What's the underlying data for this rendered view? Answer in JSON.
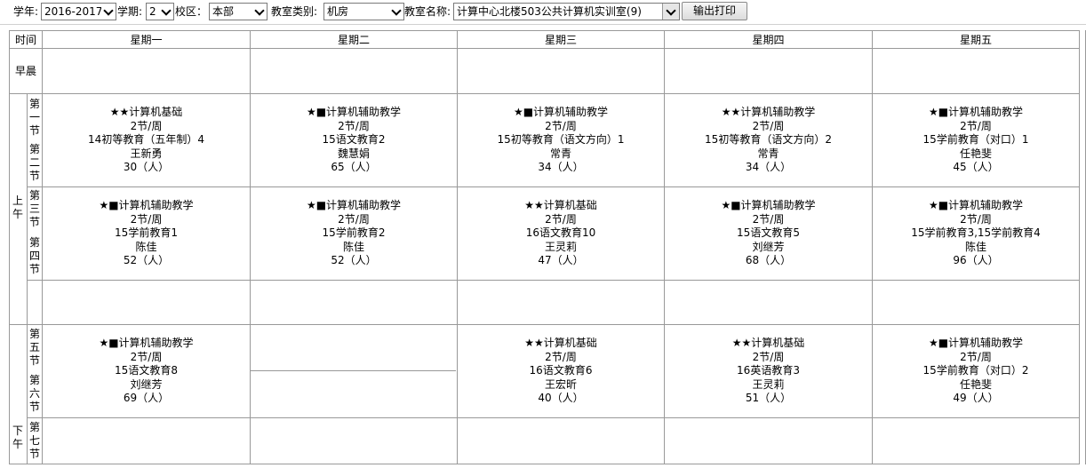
{
  "toolbar": {
    "year_label": "学年:",
    "year_value": "2016-2017",
    "term_label": "学期:",
    "term_value": "2",
    "campus_label": "校区：",
    "campus_value": "本部",
    "room_type_label": "教室类别:",
    "room_type_value": "机房",
    "room_name_label": "教室名称:",
    "room_name_value": "计算中心北楼503公共计算机实训室(9)",
    "print_label": "输出打印"
  },
  "header": {
    "time_label": "时间",
    "days": [
      "星期一",
      "星期二",
      "星期三",
      "星期四",
      "星期五"
    ]
  },
  "periods": {
    "morning_early": "早晨",
    "am": "上午",
    "pm": "下午",
    "p1": "第一节",
    "p2": "第二节",
    "p3": "第三节",
    "p4": "第四节",
    "p5": "第五节",
    "p6": "第六节",
    "p7": "第七节"
  },
  "slots": [
    {
      "name": "p1-2",
      "cells": [
        {
          "title": "★★计算机基础",
          "freq": "2节/周",
          "class_name": "14初等教育（五年制）4",
          "teacher": "王新勇",
          "count": "30（人）"
        },
        {
          "title": "★■计算机辅助教学",
          "freq": "2节/周",
          "class_name": "15语文教育2",
          "teacher": "魏慧娟",
          "count": "65（人）"
        },
        {
          "title": "★■计算机辅助教学",
          "freq": "2节/周",
          "class_name": "15初等教育（语文方向）1",
          "teacher": "常青",
          "count": "34（人）"
        },
        {
          "title": "★★计算机辅助教学",
          "freq": "2节/周",
          "class_name": "15初等教育（语文方向）2",
          "teacher": "常青",
          "count": "34（人）"
        },
        {
          "title": "★■计算机辅助教学",
          "freq": "2节/周",
          "class_name": "15学前教育（对口）1",
          "teacher": "任艳斐",
          "count": "45（人）"
        }
      ]
    },
    {
      "name": "p3-4",
      "cells": [
        {
          "title": "★■计算机辅助教学",
          "freq": "2节/周",
          "class_name": "15学前教育1",
          "teacher": "陈佳",
          "count": "52（人）"
        },
        {
          "title": "★■计算机辅助教学",
          "freq": "2节/周",
          "class_name": "15学前教育2",
          "teacher": "陈佳",
          "count": "52（人）"
        },
        {
          "title": "★★计算机基础",
          "freq": "2节/周",
          "class_name": "16语文教育10",
          "teacher": "王灵莉",
          "count": "47（人）"
        },
        {
          "title": "★■计算机辅助教学",
          "freq": "2节/周",
          "class_name": "15语文教育5",
          "teacher": "刘继芳",
          "count": "68（人）"
        },
        {
          "title": "★■计算机辅助教学",
          "freq": "2节/周",
          "class_name": "15学前教育3,15学前教育4",
          "teacher": "陈佳",
          "count": "96（人）"
        }
      ]
    },
    {
      "name": "p5-6",
      "cells": [
        {
          "title": "★■计算机辅助教学",
          "freq": "2节/周",
          "class_name": "15语文教育8",
          "teacher": "刘继芳",
          "count": "69（人）"
        },
        {
          "title": "",
          "freq": "",
          "class_name": "",
          "teacher": "",
          "count": ""
        },
        {
          "title": "★★计算机基础",
          "freq": "2节/周",
          "class_name": "16语文教育6",
          "teacher": "王宏昕",
          "count": "40（人）"
        },
        {
          "title": "★★计算机基础",
          "freq": "2节/周",
          "class_name": "16英语教育3",
          "teacher": "王灵莉",
          "count": "51（人）"
        },
        {
          "title": "★■计算机辅助教学",
          "freq": "2节/周",
          "class_name": "15学前教育（对口）2",
          "teacher": "任艳斐",
          "count": "49（人）"
        }
      ]
    }
  ]
}
